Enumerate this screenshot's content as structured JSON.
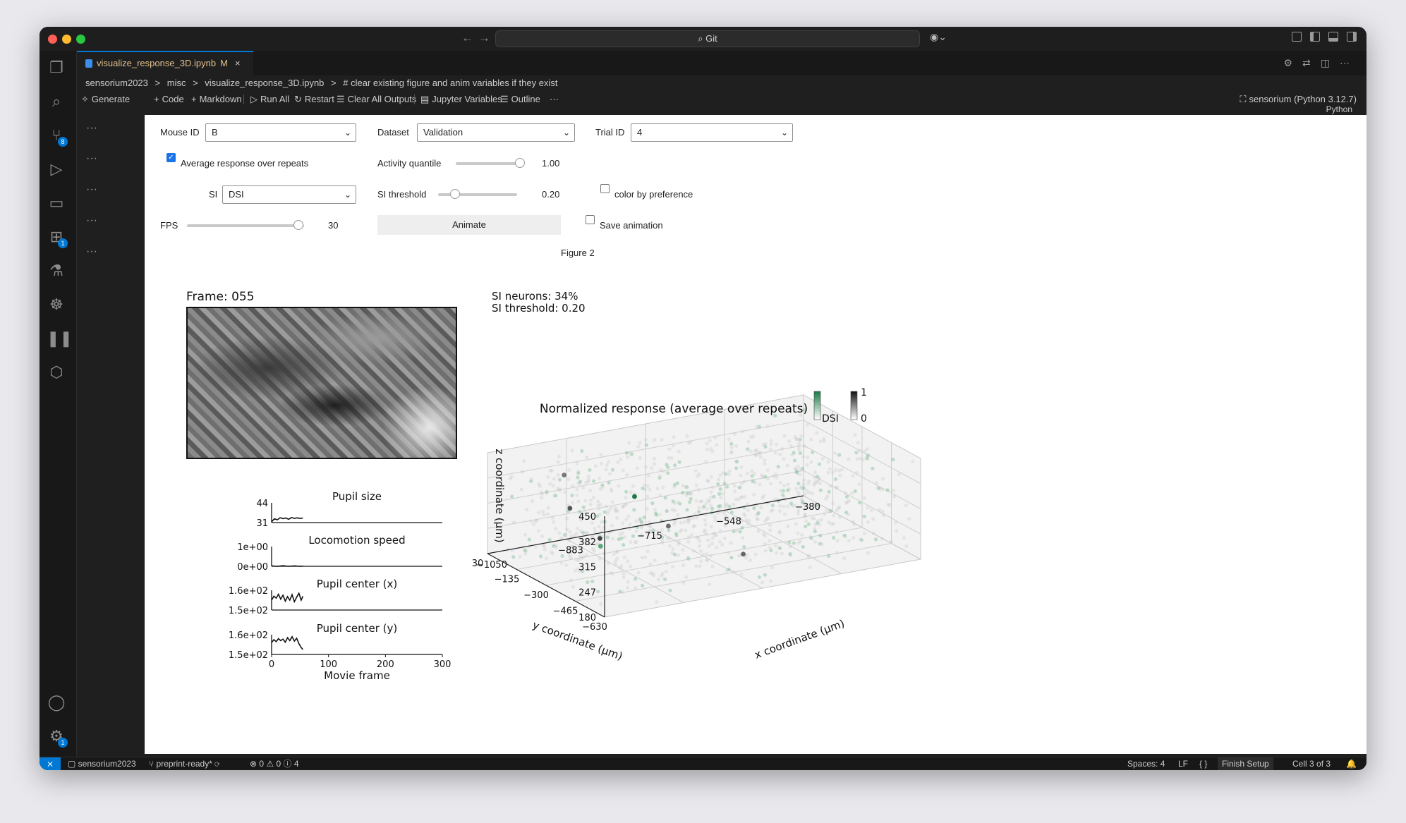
{
  "window": {
    "command_center": "Git"
  },
  "tab": {
    "filename": "visualize_response_3D.ipynb",
    "modified": "M",
    "close": "×"
  },
  "breadcrumb": {
    "items": [
      "sensorium2023",
      ">",
      "misc",
      ">",
      "visualize_response_3D.ipynb",
      ">",
      "# clear existing figure and anim variables if they exist"
    ]
  },
  "toolbar": {
    "generate": "Generate",
    "code": "Code",
    "markdown": "Markdown",
    "run_all": "Run All",
    "restart": "Restart",
    "clear_all": "Clear All Outputs",
    "variables": "Jupyter Variables",
    "outline": "Outline",
    "more": "···",
    "kernel": "sensorium (Python 3.12.7)",
    "lang": "Python"
  },
  "activity_bar": {
    "source_control_badge": "8",
    "extensions_badge": "1",
    "settings_badge": "1"
  },
  "controls": {
    "mouse_id_label": "Mouse ID",
    "mouse_id_value": "B",
    "dataset_label": "Dataset",
    "dataset_value": "Validation",
    "trial_id_label": "Trial ID",
    "trial_id_value": "4",
    "avg_repeats_label": "Average response over repeats",
    "avg_repeats_checked": true,
    "activity_quantile_label": "Activity quantile",
    "activity_quantile_value": "1.00",
    "activity_quantile_fraction": 1.0,
    "si_label": "SI",
    "si_value": "DSI",
    "si_threshold_label": "SI threshold",
    "si_threshold_value": "0.20",
    "si_threshold_fraction": 0.2,
    "color_pref_label": "color by preference",
    "color_pref_checked": false,
    "fps_label": "FPS",
    "fps_value": "30",
    "fps_fraction": 0.95,
    "animate_label": "Animate",
    "save_anim_label": "Save animation",
    "save_anim_checked": false,
    "figure_title": "Figure 2"
  },
  "figure": {
    "frame_label": "Frame: 055",
    "si_neurons": "SI neurons: 34%",
    "si_threshold": "SI threshold: 0.20",
    "colorbar_dsi_label": "DSI",
    "colorbar_max": "1",
    "colorbar_min": "0"
  },
  "chart_data": [
    {
      "type": "line",
      "title": "Pupil size",
      "xlim": [
        0,
        300
      ],
      "ylim": [
        31,
        44
      ],
      "yticks": [
        "44",
        "31"
      ],
      "x": [
        0,
        5,
        10,
        15,
        20,
        25,
        30,
        35,
        40,
        45,
        50,
        55
      ],
      "series": [
        {
          "values": [
            31.5,
            33.5,
            32.8,
            34.2,
            33.6,
            34.0,
            33.2,
            34.3,
            33.8,
            34.1,
            33.7,
            34.0
          ]
        }
      ]
    },
    {
      "type": "line",
      "title": "Locomotion speed",
      "xlim": [
        0,
        300
      ],
      "ylim": [
        0,
        1
      ],
      "yticks": [
        "1e+00",
        "0e+00"
      ],
      "x": [
        0,
        10,
        20,
        30,
        40,
        50,
        55
      ],
      "series": [
        {
          "values": [
            0.02,
            0.0,
            0.03,
            0.0,
            0.02,
            0.0,
            0.01
          ]
        }
      ]
    },
    {
      "type": "line",
      "title": "Pupil center (x)",
      "xlim": [
        0,
        300
      ],
      "ylim": [
        150,
        160
      ],
      "yticks": [
        "1.6e+02",
        "1.5e+02"
      ],
      "x": [
        0,
        4,
        8,
        12,
        16,
        20,
        24,
        28,
        32,
        36,
        40,
        44,
        48,
        52,
        55
      ],
      "series": [
        {
          "values": [
            155,
            157,
            156,
            158,
            155.5,
            157.5,
            154.5,
            156.8,
            155,
            157.8,
            154.2,
            156.5,
            158.5,
            155,
            157
          ]
        }
      ]
    },
    {
      "type": "line",
      "title": "Pupil center (y)",
      "xlim": [
        0,
        300
      ],
      "ylim": [
        150,
        160
      ],
      "yticks": [
        "1.6e+02",
        "1.5e+02"
      ],
      "xticks": [
        "0",
        "100",
        "200",
        "300"
      ],
      "xlabel": "Movie frame",
      "x": [
        0,
        4,
        8,
        12,
        16,
        20,
        24,
        28,
        32,
        36,
        40,
        44,
        48,
        52,
        55
      ],
      "series": [
        {
          "values": [
            156,
            157.5,
            156.5,
            158,
            157,
            157.8,
            156.2,
            158.5,
            157,
            159,
            156.8,
            158.2,
            155.5,
            153.5,
            152.5
          ]
        }
      ]
    },
    {
      "type": "scatter",
      "title": "Normalized response (average over repeats)",
      "xlabel": "x coordinate (µm)",
      "ylabel": "y coordinate (µm)",
      "zlabel": "z coordinate (µm)",
      "xticks": [
        "−1050",
        "−883",
        "−715",
        "−548",
        "−380"
      ],
      "yticks": [
        "−630",
        "−465",
        "−300",
        "−135",
        "30"
      ],
      "zticks": [
        "180",
        "247",
        "315",
        "382",
        "450"
      ],
      "xlim": [
        -1050,
        -380
      ],
      "ylim": [
        -630,
        30
      ],
      "zlim": [
        180,
        450
      ],
      "colorbar": {
        "label": "DSI",
        "max": "1",
        "min": "0"
      }
    }
  ]
}
